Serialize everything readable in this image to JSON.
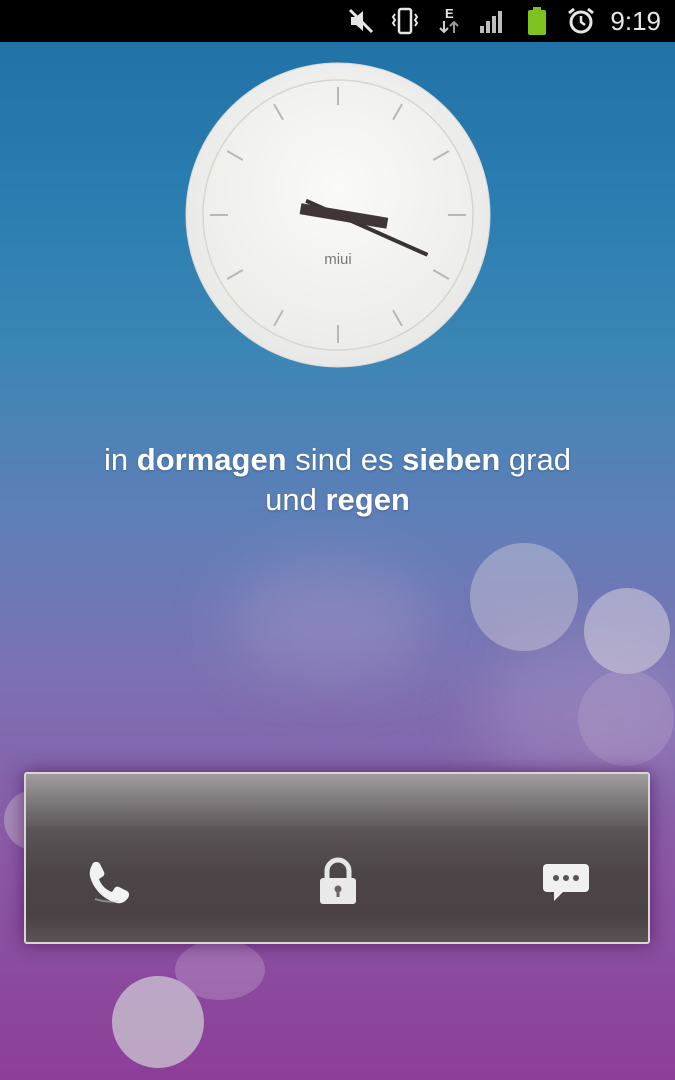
{
  "status_bar": {
    "time": "9:19",
    "network_type": "E",
    "icons": [
      "mute-icon",
      "vibrate-icon",
      "network-e-icon",
      "signal-icon",
      "battery-icon",
      "alarm-icon"
    ],
    "battery_color": "#7ec322"
  },
  "clock": {
    "brand": "miui",
    "hour": 9,
    "minute": 19
  },
  "weather": {
    "part1": "in ",
    "city": "dormagen",
    "part2": " sind es ",
    "temperature_word": "sieben",
    "part3": " grad",
    "part4": "und ",
    "condition": "regen"
  },
  "unlock_bar": {
    "left_icon": "phone-icon",
    "center_icon": "lock-icon",
    "right_icon": "message-icon"
  }
}
